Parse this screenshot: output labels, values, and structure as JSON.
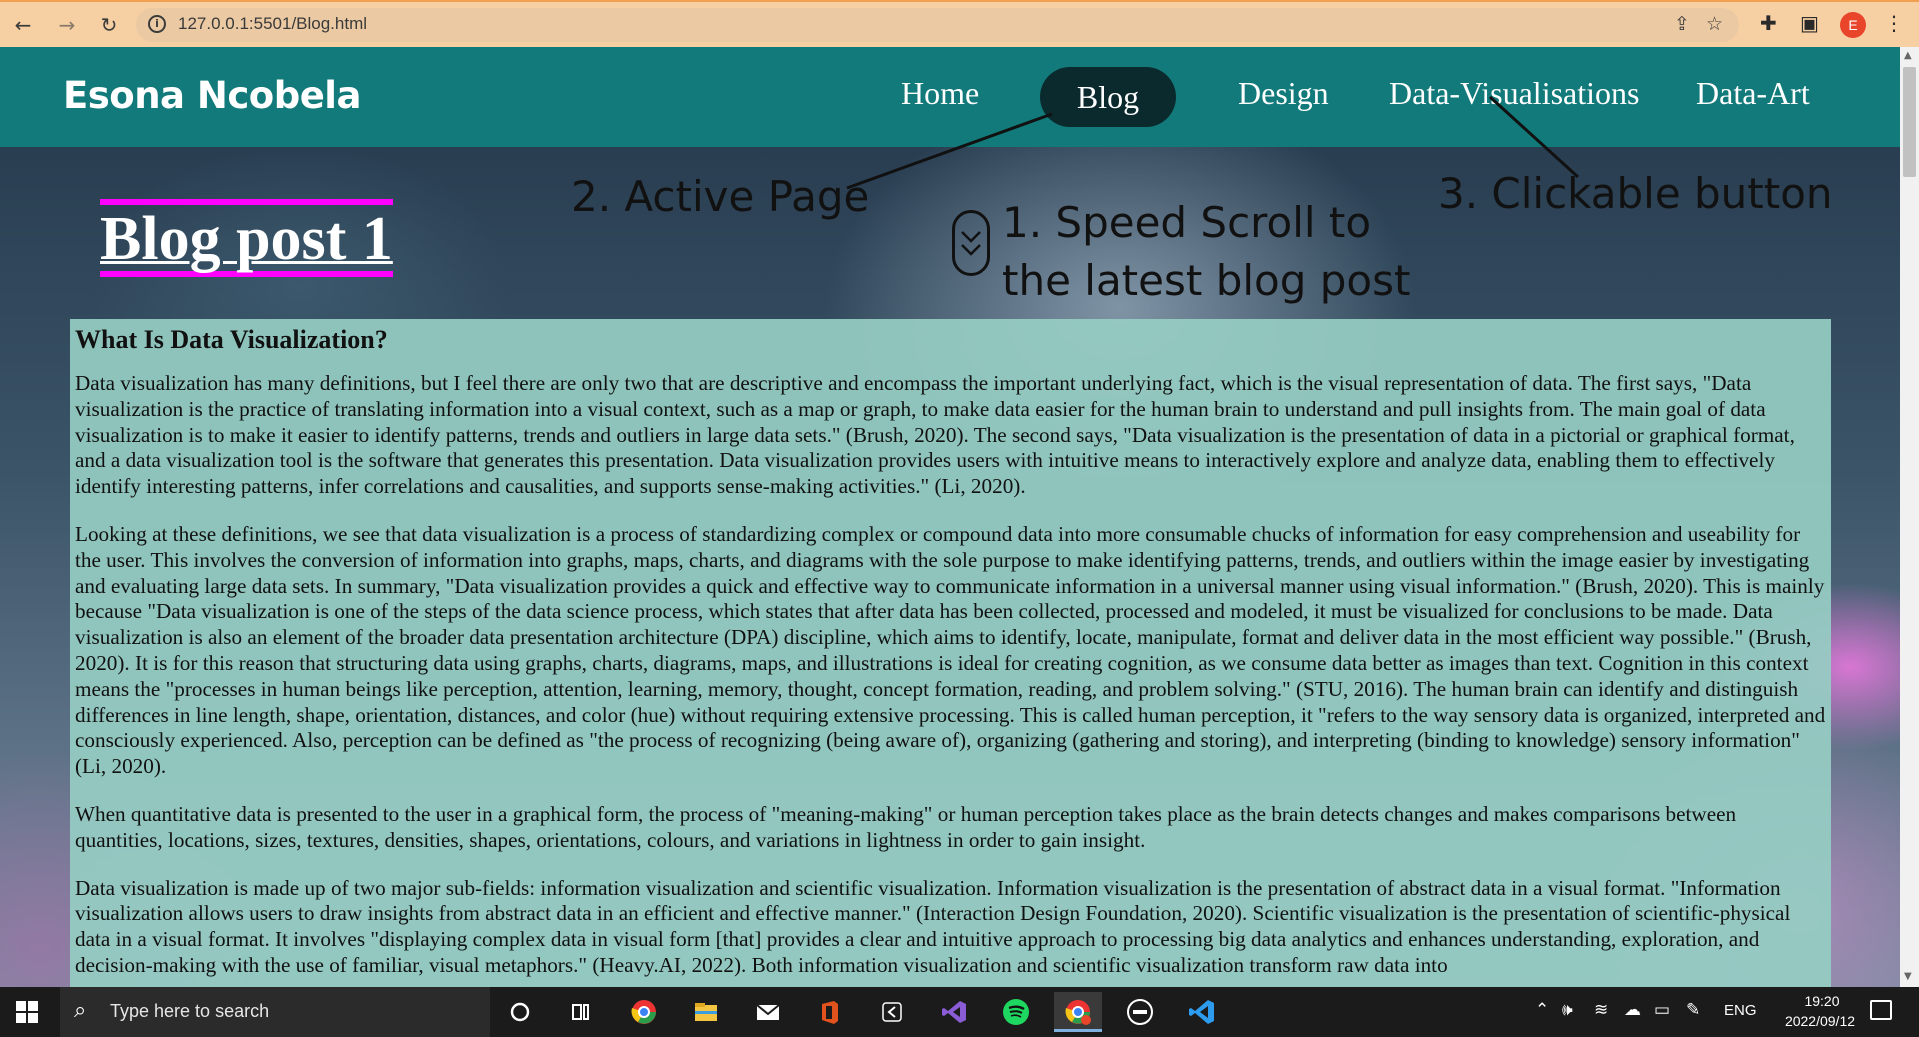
{
  "browser": {
    "url": "127.0.0.1:5501/Blog.html",
    "profile_initial": "E",
    "icons": [
      "back-icon",
      "forward-icon",
      "reload-icon",
      "site-info-icon",
      "share-icon",
      "bookmark-star-icon",
      "extensions-puzzle-icon",
      "side-panel-icon",
      "profile-avatar",
      "menu-kebab-icon"
    ]
  },
  "header": {
    "site_name": "Esona Ncobela",
    "nav": [
      {
        "label": "Home"
      },
      {
        "label": "Blog",
        "active": true
      },
      {
        "label": "Design"
      },
      {
        "label": "Data-Visualisations"
      },
      {
        "label": "Data-Art"
      }
    ]
  },
  "post": {
    "title": "Blog post 1"
  },
  "annotations": {
    "active_page": "2. Active Page",
    "speed_scroll_line1": "1. Speed Scroll to",
    "speed_scroll_line2": "the latest blog post",
    "clickable_button": "3. Clickable button"
  },
  "article": {
    "heading": "What Is Data Visualization?",
    "paragraphs": [
      "Data visualization has many definitions, but I feel there are only two that are descriptive and encompass the important underlying fact, which is the visual representation of data. The first says, \"Data visualization is the practice of translating information into a visual context, such as a map or graph, to make data easier for the human brain to understand and pull insights from. The main goal of data visualization is to make it easier to identify patterns, trends and outliers in large data sets.\" (Brush, 2020). The second says, \"Data visualization is the presentation of data in a pictorial or graphical format, and a data visualization tool is the software that generates this presentation. Data visualization provides users with intuitive means to interactively explore and analyze data, enabling them to effectively identify interesting patterns, infer correlations and causalities, and supports sense-making activities.\" (Li, 2020).",
      "Looking at these definitions, we see that data visualization is a process of standardizing complex or compound data into more consumable chucks of information for easy comprehension and useability for the user. This involves the conversion of information into graphs, maps, charts, and diagrams with the sole purpose to make identifying patterns, trends, and outliers within the image easier by investigating and evaluating large data sets. In summary, \"Data visualization provides a quick and effective way to communicate information in a universal manner using visual information.\" (Brush, 2020). This is mainly because \"Data visualization is one of the steps of the data science process, which states that after data has been collected, processed and modeled, it must be visualized for conclusions to be made. Data visualization is also an element of the broader data presentation architecture (DPA) discipline, which aims to identify, locate, manipulate, format and deliver data in the most efficient way possible.\" (Brush, 2020). It is for this reason that structuring data using graphs, charts, diagrams, maps, and illustrations is ideal for creating cognition, as we consume data better as images than text. Cognition in this context means the \"processes in human beings like perception, attention, learning, memory, thought, concept formation, reading, and problem solving.\" (STU, 2016). The human brain can identify and distinguish differences in line length, shape, orientation, distances, and color (hue) without requiring extensive processing. This is called human perception, it \"refers to the way sensory data is organized, interpreted and consciously experienced. Also, perception can be defined as \"the process of recognizing (being aware of), organizing (gathering and storing), and interpreting (binding to knowledge) sensory information\" (Li, 2020).",
      "When quantitative data is presented to the user in a graphical form, the process of \"meaning-making\" or human perception takes place as the brain detects changes and makes comparisons between quantities, locations, sizes, textures, densities, shapes, orientations, colours, and variations in lightness in order to gain insight.",
      "Data visualization is made up of two major sub-fields: information visualization and scientific visualization. Information visualization is the presentation of abstract data in a visual format. \"Information visualization allows users to draw insights from abstract data in an efficient and effective manner.\" (Interaction Design Foundation, 2020). Scientific visualization is the presentation of scientific-physical data in a visual format. It involves \"displaying complex data in visual form [that] provides a clear and intuitive approach to processing big data analytics and enhances understanding, exploration, and decision-making with the use of familiar, visual metaphors.\" (Heavy.AI, 2022). Both information visualization and scientific visualization transform raw data into"
    ]
  },
  "taskbar": {
    "search_placeholder": "Type here to search",
    "language": "ENG",
    "time": "19:20",
    "date": "2022/09/12"
  },
  "colors": {
    "header": "#127a7a",
    "active_pill": "#0a2a2e",
    "title_border": "#ff00ff",
    "article_bg": "#96cdc3",
    "chrome": "#f6cfa3"
  }
}
